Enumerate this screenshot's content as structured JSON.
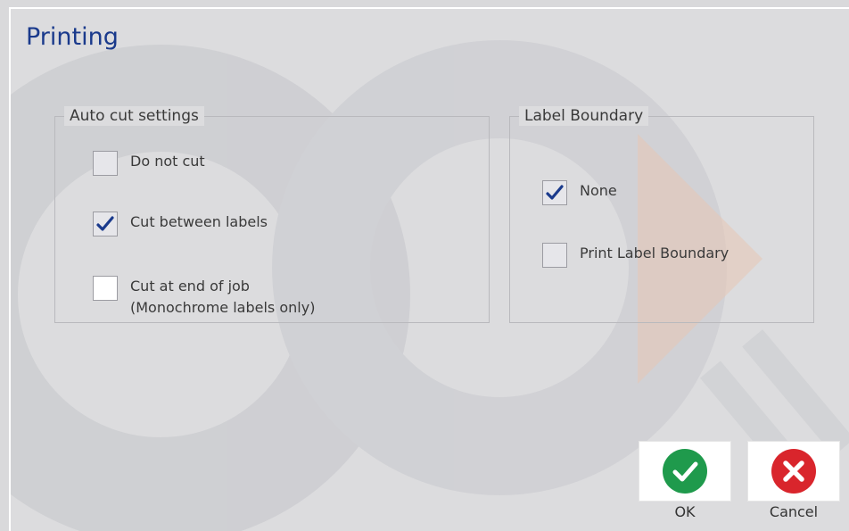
{
  "window": {
    "title": "Printing"
  },
  "auto_cut": {
    "legend": "Auto cut settings",
    "options": [
      {
        "label": "Do not cut",
        "checked": false
      },
      {
        "label": "Cut between labels",
        "checked": true
      },
      {
        "label": "Cut at end of job",
        "sublabel": "(Monochrome labels only)",
        "checked": false
      }
    ]
  },
  "label_boundary": {
    "legend": "Label Boundary",
    "options": [
      {
        "label": "None",
        "checked": true
      },
      {
        "label": "Print Label Boundary",
        "checked": false
      }
    ]
  },
  "buttons": {
    "ok": {
      "label": "OK",
      "icon": "check-circle-icon",
      "color": "#1f9a4c"
    },
    "cancel": {
      "label": "Cancel",
      "icon": "x-circle-icon",
      "color": "#d9252c"
    }
  },
  "colors": {
    "title": "#1a3a8c",
    "checkmark": "#1a3a8c"
  }
}
